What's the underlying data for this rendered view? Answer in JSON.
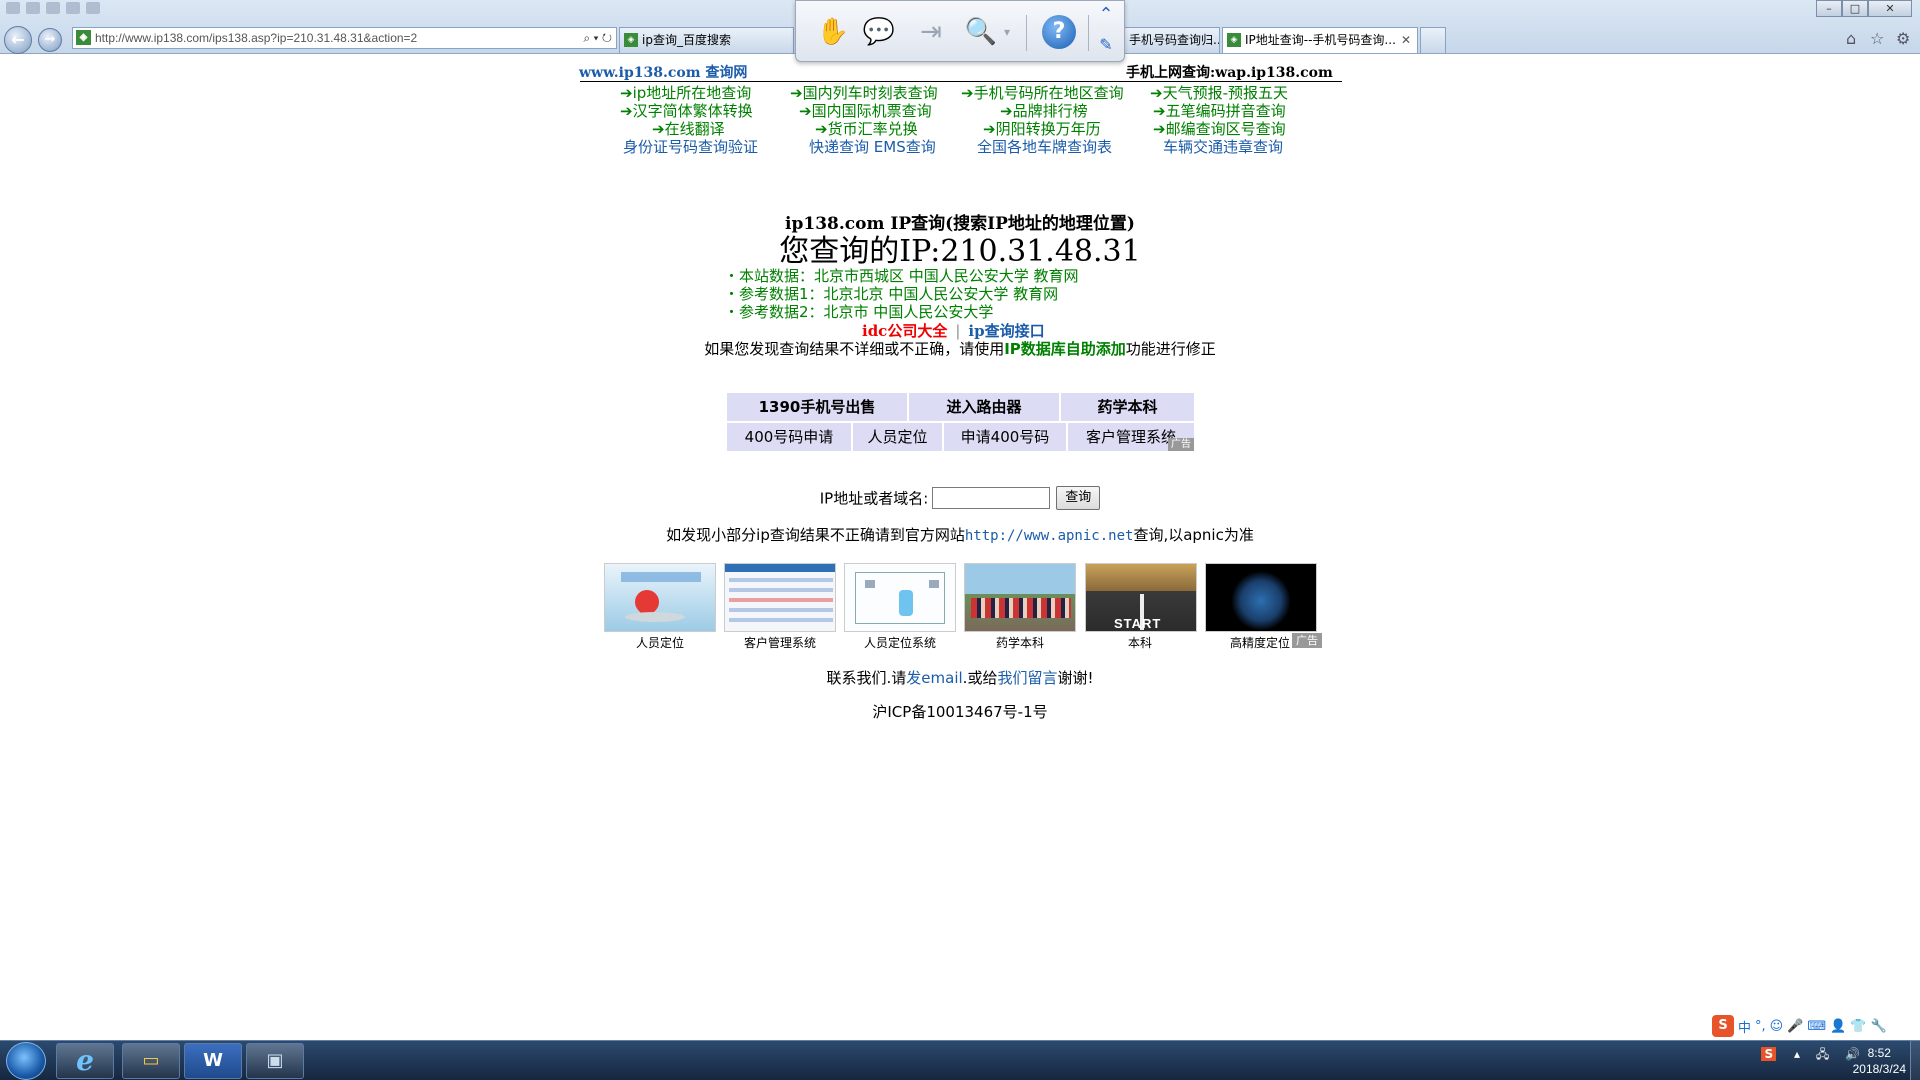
{
  "browser": {
    "url": "http://www.ip138.com/ips138.asp?ip=210.31.48.31&action=2",
    "url_host": "ip138.com",
    "tabs": [
      {
        "title": "ip查询_百度搜索"
      },
      {
        "title": "手机号码查询归..."
      },
      {
        "title": "IP地址查询--手机号码查询..."
      }
    ],
    "window_controls": {
      "minimize": "–",
      "maximize": "□",
      "close": "✕"
    }
  },
  "header": {
    "left": "www.ip138.com 查询网",
    "right": "手机上网查询:wap.ip138.com"
  },
  "link_grid": [
    [
      "ip地址所在地查询",
      "国内列车时刻表查询",
      "手机号码所在地区查询",
      "天气预报-预报五天"
    ],
    [
      "汉字简体繁体转换",
      "国内国际机票查询",
      "品牌排行榜",
      "五笔编码拼音查询"
    ],
    [
      "在线翻译",
      "货币汇率兑换",
      "阴阳转换万年历",
      "邮编查询区号查询"
    ],
    [
      "身份证号码查询验证",
      "快递查询 EMS查询",
      "全国各地车牌查询表",
      "车辆交通违章查询"
    ]
  ],
  "result": {
    "title": "ip138.com IP查询(搜索IP地址的地理位置)",
    "ip_line": "您查询的IP:210.31.48.31",
    "data_lines": [
      "・本站数据：北京市西城区 中国人民公安大学 教育网",
      "・参考数据1：北京北京 中国人民公安大学 教育网",
      "・参考数据2：北京市 中国人民公安大学"
    ],
    "idc_link": "idc公司大全",
    "sep": "|",
    "api_link": "ip查询接口",
    "fix_before": "如果您发现查询结果不详细或不正确，请使用",
    "fix_link": "IP数据库自助添加",
    "fix_after": "功能进行修正"
  },
  "ad_table": {
    "row1": [
      "1390手机号出售",
      "进入路由器",
      "药学本科"
    ],
    "row2": [
      "400号码申请",
      "人员定位",
      "申请400号码",
      "客户管理系统"
    ],
    "tag": "广告"
  },
  "query": {
    "label": "IP地址或者域名:",
    "input_value": "",
    "button": "查询"
  },
  "apnic": {
    "before": "如发现小部分ip查询结果不正确请到官方网站",
    "link": "http://www.apnic.net",
    "after": "查询,以apnic为准"
  },
  "thumbs": [
    {
      "label": "人员定位"
    },
    {
      "label": "客户管理系统"
    },
    {
      "label": "人员定位系统"
    },
    {
      "label": "药学本科"
    },
    {
      "label": "本科"
    },
    {
      "label": "高精度定位"
    }
  ],
  "thumb_tag": "广告",
  "contact": {
    "before": "联系我们.请",
    "email": "发email",
    "middle": ".或给",
    "msg": "我们留言",
    "after": "谢谢!"
  },
  "icp": "沪ICP备10013467号-1号",
  "taskbar": {
    "time": "8:52",
    "date": "2018/3/24",
    "ime": "中"
  }
}
